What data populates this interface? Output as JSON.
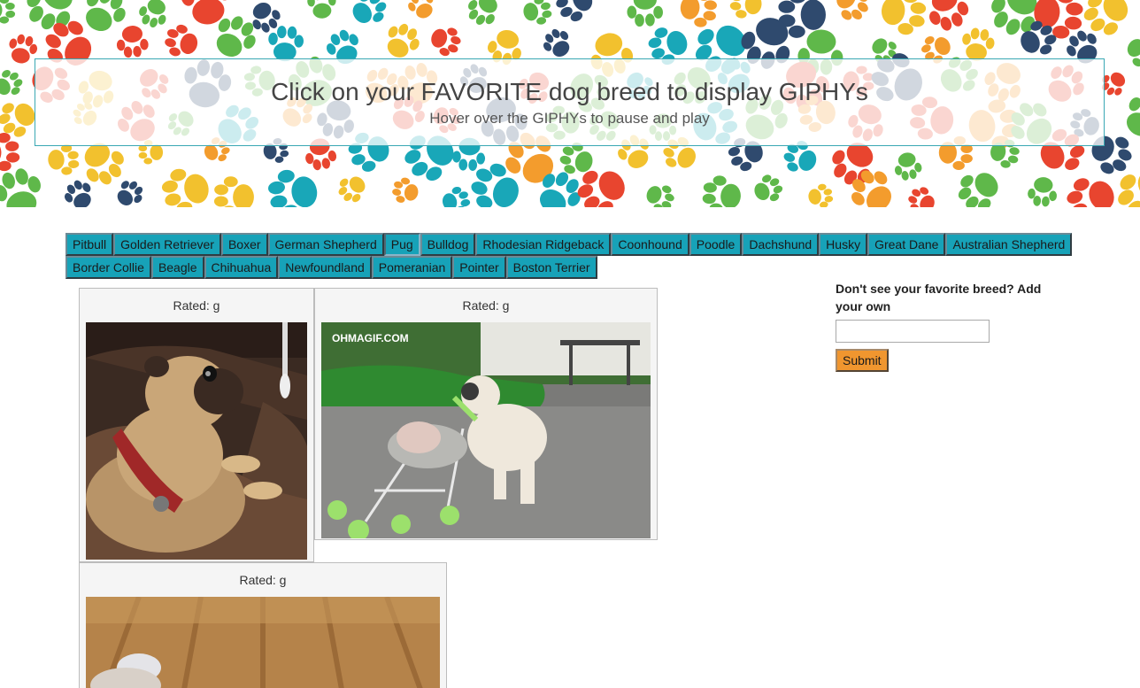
{
  "header": {
    "title": "Click on your FAVORITE dog breed to display GIPHYs",
    "subtitle": "Hover over the GIPHYs to pause and play"
  },
  "breeds": {
    "row1": [
      "Pitbull",
      "Golden Retriever",
      "Boxer",
      "German Shepherd",
      "Pug",
      "Bulldog",
      "Rhodesian Ridgeback",
      "Coonhound",
      "Poodle",
      "Dachshund",
      "Husky",
      "Great Dane",
      "Australian Shepherd"
    ],
    "row2": [
      "Border Collie",
      "Beagle",
      "Chihuahua",
      "Newfoundland",
      "Pomeranian",
      "Pointer",
      "Boston Terrier"
    ],
    "active": "Pug"
  },
  "gifs": [
    {
      "rating_label": "Rated: g",
      "subject": "pug on couch with red collar"
    },
    {
      "rating_label": "Rated: g",
      "subject": "pug pushing stroller",
      "watermark": "OHMAGIF.COM"
    },
    {
      "rating_label": "Rated: g",
      "subject": "pug on wood floor"
    }
  ],
  "add_form": {
    "label": "Don't see your favorite breed? Add your own",
    "input_value": "",
    "submit_label": "Submit"
  },
  "colors": {
    "breed_button": "#17a2b8",
    "submit_button": "#f0962f",
    "header_border": "#3aa8b4"
  }
}
